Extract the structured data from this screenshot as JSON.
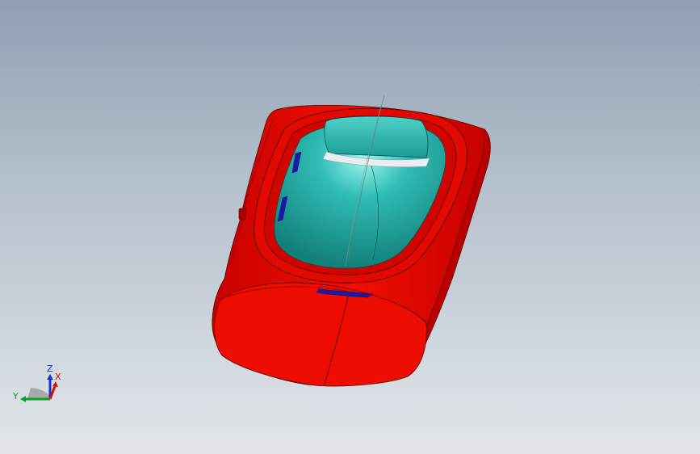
{
  "viewport": {
    "background_top": "#8f9fb2",
    "background_bottom": "#e2e6ea"
  },
  "model": {
    "shell_color": "#e60c00",
    "shell_shadow": "#a80000",
    "interior_color": "#1fa9a3",
    "interior_highlight": "#7fe6e0",
    "trim_color": "#e8eef0",
    "accent_color": "#1a1aa8"
  },
  "triad": {
    "z_label": "Z",
    "x_label": "X",
    "y_label": "Y",
    "z_color": "#1a2fd0",
    "x_color": "#d01010",
    "y_color": "#10a020"
  }
}
